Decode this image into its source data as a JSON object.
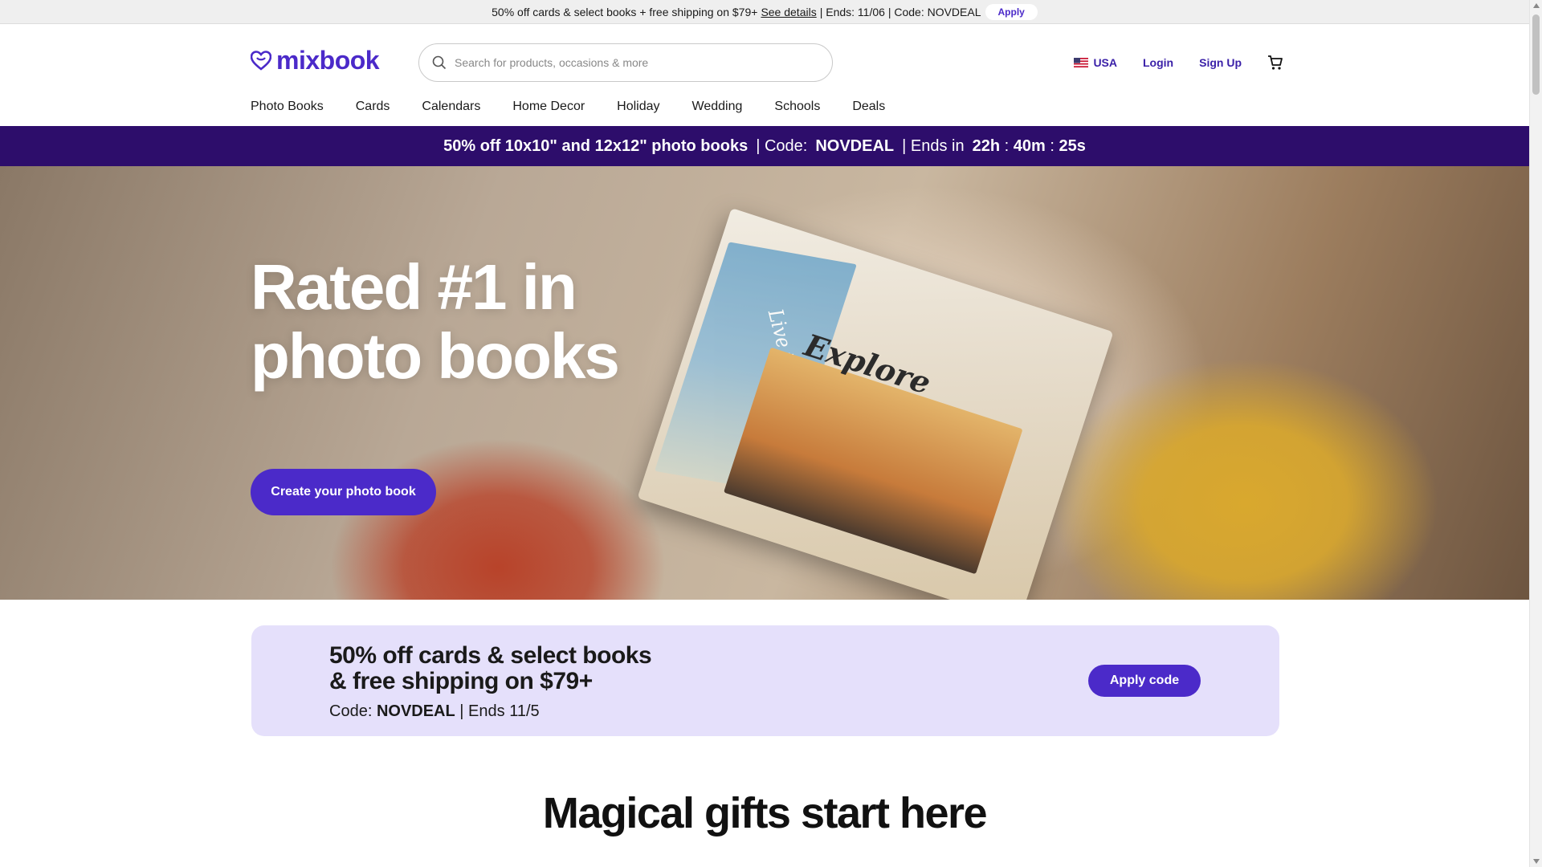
{
  "topbar": {
    "text": "50% off cards & select books + free shipping on $79+",
    "details_link": "See details",
    "ends_text": "| Ends: 11/06 | Code: NOVDEAL",
    "apply_label": "Apply"
  },
  "header": {
    "logo_text": "mixbook",
    "search_placeholder": "Search for products, occasions & more",
    "country": "USA",
    "login": "Login",
    "signup": "Sign Up"
  },
  "nav": {
    "items": [
      {
        "label": "Photo Books"
      },
      {
        "label": "Cards"
      },
      {
        "label": "Calendars"
      },
      {
        "label": "Home Decor"
      },
      {
        "label": "Holiday"
      },
      {
        "label": "Wedding"
      },
      {
        "label": "Schools"
      },
      {
        "label": "Deals"
      }
    ]
  },
  "promo": {
    "headline": "50% off 10x10\" and 12x12\" photo books",
    "code_label": "| Code:",
    "code": "NOVDEAL",
    "ends_label": "| Ends in",
    "hours": "22h",
    "minutes": "40m",
    "seconds": "25s",
    "colon": ":"
  },
  "hero": {
    "title_line1": "Rated #1 in",
    "title_line2": "photo books",
    "cta": "Create your photo book",
    "book_title": "Explore",
    "book_side_text": "Live to travel"
  },
  "offer": {
    "headline_line1": "50% off cards & select books",
    "headline_line2": "& free shipping on $79+",
    "code_label": "Code:",
    "code": "NOVDEAL",
    "ends": "| Ends 11/5",
    "button": "Apply code"
  },
  "section": {
    "heading": "Magical gifts start here"
  },
  "colors": {
    "brand_purple": "#4b2ac9",
    "promo_bar": "#2d0d6b",
    "offer_bg": "#e5e0fb"
  }
}
